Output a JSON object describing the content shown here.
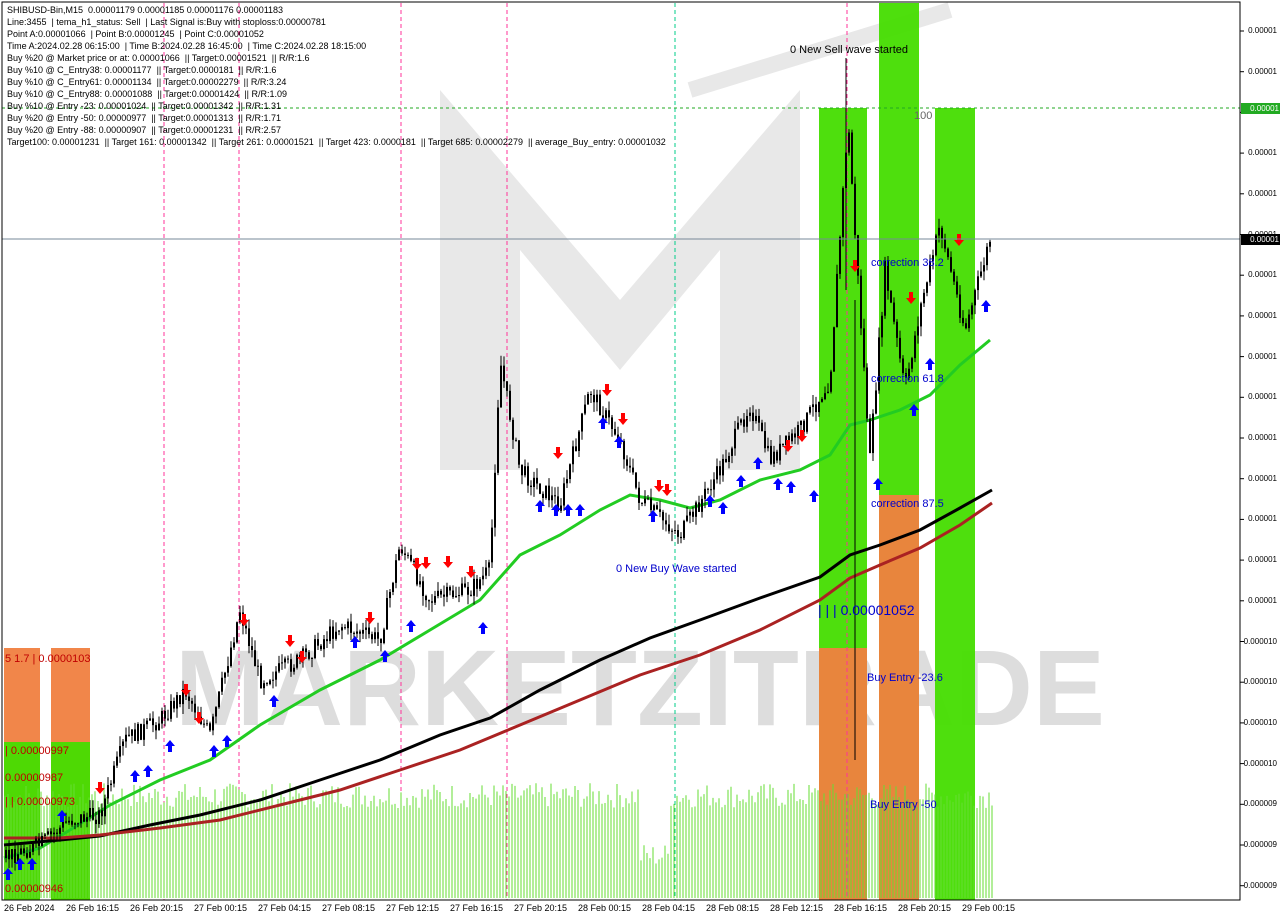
{
  "header": {
    "lines": [
      "SHIBUSD-Bin,M15  0.00001179 0.00001185 0.00001176 0.00001183",
      "Line:3455  | tema_h1_status: Sell  | Last Signal is:Buy with stoploss:0.00000781",
      "Point A:0.00001066  | Point B:0.00001245  | Point C:0.00001052",
      "Time A:2024.02.28 06:15:00  | Time B:2024.02.28 16:45:00  | Time C:2024.02.28 18:15:00",
      "Buy %20 @ Market price or at: 0.00001066  || Target:0.00001521  || R/R:1.6",
      "Buy %10 @ C_Entry38: 0.00001177  || Target:0.0000181  || R/R:1.6",
      "Buy %10 @ C_Entry61: 0.00001134  || Target:0.00002279  || R/R:3.24",
      "Buy %10 @ C_Entry88: 0.00001088  || Target:0.00001424  || R/R:1.09",
      "Buy %10 @ Entry -23: 0.00001024  || Target:0.00001342  || R/R:1.31",
      "Buy %20 @ Entry -50: 0.00000977  || Target:0.00001313  || R/R:1.71",
      "Buy %20 @ Entry -88: 0.00000907  || Target:0.00001231  || R/R:2.57",
      "Target100: 0.00001231  || Target 161: 0.00001342  || Target 261: 0.00001521  || Target 423: 0.0000181  || Target 685: 0.00002279  || average_Buy_entry: 0.00001032"
    ]
  },
  "annotations": {
    "sell_wave": "0 New Sell wave started",
    "buy_wave": "0 New Buy Wave started",
    "level_100": "100",
    "correction_38": "correction 38.2",
    "correction_61": "correction 61.8",
    "correction_87": "correction 87.5",
    "point_c": "| | | 0.00001052",
    "buy_entry_23": "Buy Entry -23.6",
    "buy_entry_50": "Buy Entry -50",
    "left_top": "5 1.7 | 0.0000103",
    "left_997": "| 0.00000997",
    "left_987": "0.00000987",
    "left_973": "| | 0.00000973",
    "left_946": "0.00000946"
  },
  "price_axis": [
    "0.00001",
    "0.00001",
    "0.00001",
    "0.00001",
    "0.00001",
    "0.00001",
    "0.00001",
    "0.00001",
    "0.00001",
    "0.00001",
    "0.00001",
    "0.00001",
    "0.00001",
    "0.00001",
    "0.00001",
    "0.000010",
    "0.000010",
    "0.000010",
    "0.000010",
    "0.000009",
    "0.000009",
    "0.000009"
  ],
  "price_tags": {
    "target_line": "0.00001",
    "current_price": "0.00001"
  },
  "time_axis": [
    "26 Feb 2024",
    "26 Feb 16:15",
    "26 Feb 20:15",
    "27 Feb 00:15",
    "27 Feb 04:15",
    "27 Feb 08:15",
    "27 Feb 12:15",
    "27 Feb 16:15",
    "27 Feb 20:15",
    "28 Feb 00:15",
    "28 Feb 04:15",
    "28 Feb 08:15",
    "28 Feb 12:15",
    "28 Feb 16:15",
    "28 Feb 20:15",
    "29 Feb 00:15"
  ],
  "watermark": "MARKETZITRADE",
  "colors": {
    "green_zone": "#44dd00",
    "orange_zone": "#f08040",
    "bull_candle": "#000000",
    "ma_fast": "#22cc22",
    "ma_slow": "#000000",
    "ma_slowest": "#aa2222",
    "buy_arrow": "#0000ff",
    "sell_arrow": "#ff0000",
    "volume": "#66dd33"
  },
  "chart_data": {
    "type": "candlestick",
    "symbol": "SHIBUSD-Bin",
    "timeframe": "M15",
    "ohlc_last": {
      "open": 1.179e-05,
      "high": 1.185e-05,
      "low": 1.176e-05,
      "close": 1.183e-05
    },
    "points": {
      "A": 1.066e-05,
      "B": 1.245e-05,
      "C": 1.052e-05
    },
    "targets": {
      "t100": 1.231e-05,
      "t161": 1.342e-05,
      "t261": 1.521e-05,
      "t423": 1.81e-05,
      "t685": 2.279e-05
    },
    "average_buy_entry": 1.032e-05,
    "x_ticks": [
      "26 Feb 2024",
      "26 Feb 16:15",
      "26 Feb 20:15",
      "27 Feb 00:15",
      "27 Feb 04:15",
      "27 Feb 08:15",
      "27 Feb 12:15",
      "27 Feb 16:15",
      "27 Feb 20:15",
      "28 Feb 00:15",
      "28 Feb 04:15",
      "28 Feb 08:15",
      "28 Feb 12:15",
      "28 Feb 16:15",
      "28 Feb 20:15",
      "29 Feb 00:15"
    ],
    "grid": false
  }
}
